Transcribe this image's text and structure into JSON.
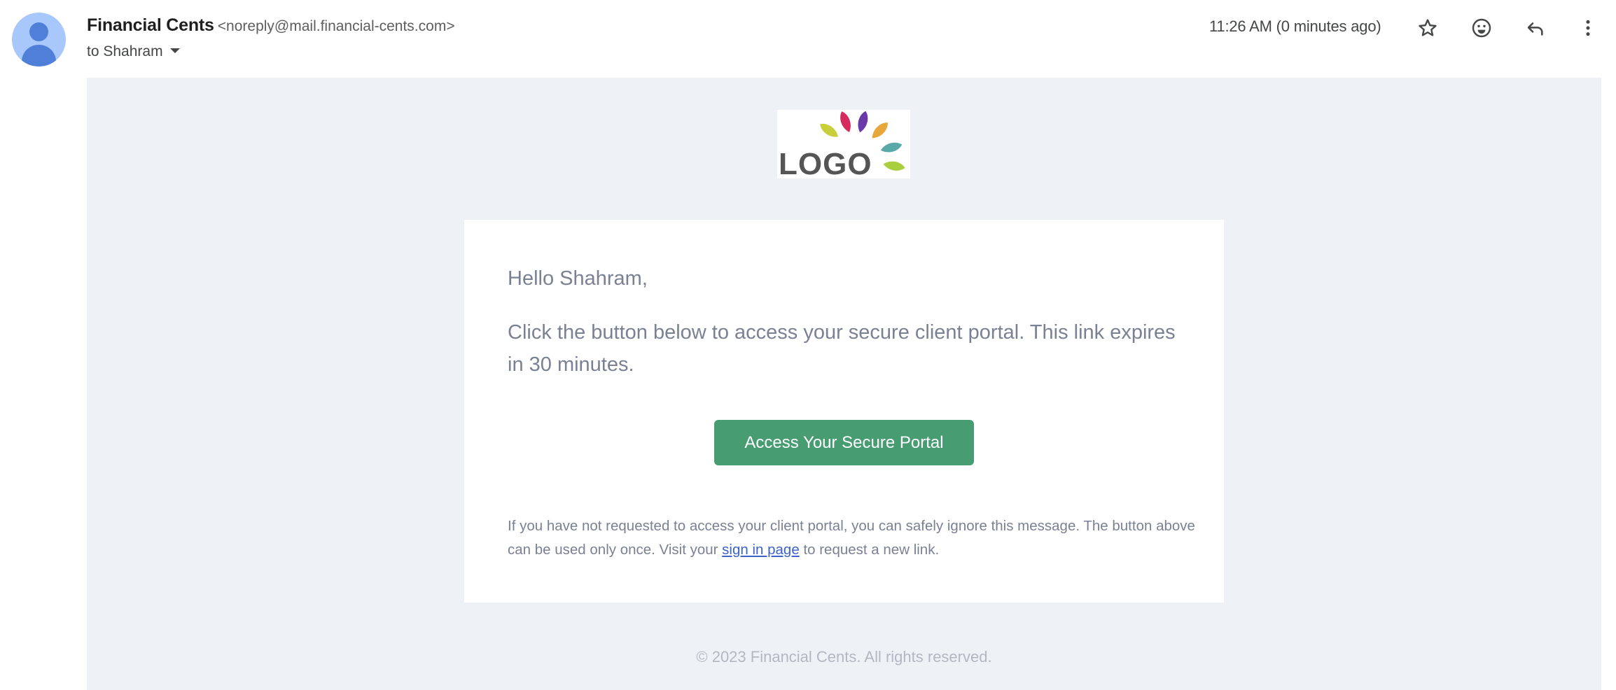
{
  "header": {
    "sender_name": "Financial Cents",
    "sender_email": "<noreply@mail.financial-cents.com>",
    "recipient": "to Shahram",
    "timestamp": "11:26 AM (0 minutes ago)",
    "actions": [
      {
        "name": "star",
        "icon": "star-outline-icon"
      },
      {
        "name": "react",
        "icon": "emoji-icon"
      },
      {
        "name": "reply",
        "icon": "reply-icon"
      },
      {
        "name": "more",
        "icon": "more-vertical-icon"
      }
    ]
  },
  "email": {
    "logo_text": "LOGO",
    "logo_leaf_colors": [
      "#c9cf3b",
      "#d6295e",
      "#6a3aa8",
      "#e7a73a",
      "#5aa9a9",
      "#a9cf3e"
    ],
    "greeting": "Hello Shahram,",
    "intro": "Click the button below to access your secure client portal. This link expires in 30 minutes.",
    "cta_label": "Access Your Secure Portal",
    "notice_before": "If you have not requested to access your client portal, you can safely ignore this message. The button above can be used only once. Visit your ",
    "notice_link": "sign in page",
    "notice_after": " to request a new link.",
    "footer": "© 2023 Financial Cents. All rights reserved."
  },
  "colors": {
    "accent_button": "#489c71",
    "body_background": "#eef2f6",
    "link": "#3c63c9"
  }
}
